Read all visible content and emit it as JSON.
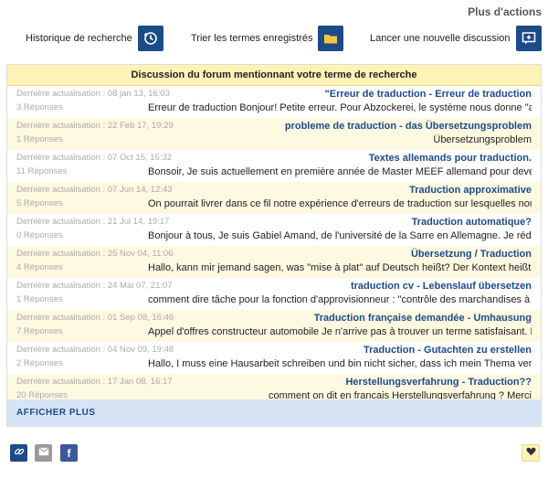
{
  "page_title": "Plus d'actions",
  "actions": {
    "history_label": "Historique de recherche",
    "sort_label": "Trier les termes enregistrés",
    "new_discussion_label": "Lancer une nouvelle discussion"
  },
  "forum": {
    "header": "Discussion du forum mentionnant votre terme de recherche",
    "rows": [
      {
        "title": "\"Erreur de traduction - Erreur de traduction",
        "excerpt": "Erreur de traduction Bonjour! Petite erreur. Pour Abzockerei, le système nous donne \"anarqu...",
        "meta": "Dernière actualisation : 08 jan 13, 16:03",
        "replies": "3 Réponses"
      },
      {
        "title": "probleme de traduction - das Übersetzungsproblem",
        "excerpt": "Übersetzungsproblem",
        "meta": "Dernière actualisation : 22 Feb 17, 19:29",
        "replies": "1 Réponses"
      },
      {
        "title": "Textes allemands pour traduction.",
        "excerpt": "Bonsoir, Je suis actuellement en première année de Master MEEF allemand pour devenir donc,...",
        "meta": "Dernière actualisation : 07 Oct 15, 15:32",
        "replies": "11 Réponses"
      },
      {
        "title": "Traduction approximative",
        "excerpt": "On pourrait livrer dans ce fil notre expérience d'erreurs de traduction sur lesquelles nous ...",
        "meta": "Dernière actualisation : 07 Jun 14, 12:43",
        "replies": "5 Réponses"
      },
      {
        "title": "Traduction automatique?",
        "excerpt": "Bonjour à tous, Je suis Gabiel Amand, de l'université de la Sarre en Allemagne. Je rédig...",
        "meta": "Dernière actualisation : 21 Jul 14, 19:17",
        "replies": "0 Réponses"
      },
      {
        "title": "Übersetzung / Traduction",
        "excerpt": "Hallo, kann mir jemand sagen, was \"mise à plat\" auf Deutsch heißt? Der Kontext heißt \"mis...",
        "meta": "Dernière actualisation : 25 Nov 04, 11:06",
        "replies": "4 Réponses"
      },
      {
        "title": "traduction cv - Lebenslauf übersetzen",
        "excerpt": "comment dire tâche pour la fonction d'approvisionneur : \"contrôle des marchandises à l...",
        "meta": "Dernière actualisation : 24 Mai 07, 21:07",
        "replies": "1 Réponses"
      },
      {
        "title": "Traduction française demandée - Umhausung",
        "excerpt": "Appel d'offres constructeur automobile Je n'arrive pas à trouver un terme satisfaisant. Pou...",
        "meta": "Dernière actualisation : 01 Sep 08, 16:46",
        "replies": "7 Réponses"
      },
      {
        "title": "Traduction - Gutachten zu erstellen",
        "excerpt": "Hallo, I muss eine Hausarbeit schreiben und bin nicht sicher, dass ich mein Thema verstande...",
        "meta": "Dernière actualisation : 04 Nov 09, 19:48",
        "replies": "2 Réponses"
      },
      {
        "title": "Herstellungsverfahrung - Traduction??",
        "excerpt": "comment on dit en francais Herstellungsverfahrung ? Merci",
        "meta": "Dernière actualisation : 17 Jan 08, 16:17",
        "replies": "20 Réponses"
      }
    ],
    "more_label": "AFFICHER PLUS"
  },
  "share": {
    "link_icon": "link-icon",
    "mail_icon": "mail-icon",
    "facebook_icon": "facebook-icon",
    "facebook_glyph": "f",
    "favorite_icon": "heart-icon"
  },
  "colors": {
    "brand_blue": "#1c4b8a",
    "header_yellow": "#fef3b7",
    "row_alt": "#fef9e1",
    "more_bar": "#d6e4f5"
  }
}
